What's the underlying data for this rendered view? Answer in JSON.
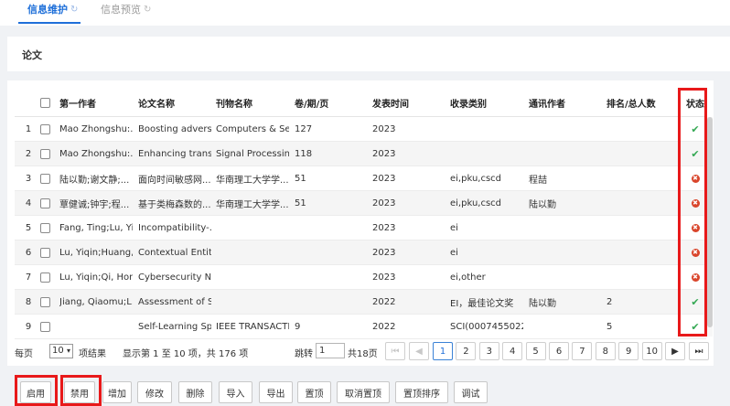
{
  "tabs": [
    {
      "label": "信息维护",
      "refresh_icon": "↻"
    },
    {
      "label": "信息预览",
      "refresh_icon": "↻"
    }
  ],
  "section": {
    "title": "论文"
  },
  "table": {
    "columns": [
      "第一作者",
      "论文名称",
      "刊物名称",
      "卷/期/页",
      "发表时间",
      "收录类别",
      "通讯作者",
      "排名/总人数",
      "状态"
    ],
    "rows": [
      {
        "idx": "1",
        "author": "Mao Zhongshu:...",
        "title": "Boosting advers...",
        "journal": "Computers & Se...",
        "vol": "127",
        "year": "2023",
        "index": "",
        "corresponding": "",
        "rank": "",
        "status": "enabled"
      },
      {
        "idx": "2",
        "author": "Mao Zhongshu:...",
        "title": "Enhancing trans...",
        "journal": "Signal Processin...",
        "vol": "118",
        "year": "2023",
        "index": "",
        "corresponding": "",
        "rank": "",
        "status": "enabled"
      },
      {
        "idx": "3",
        "author": "陆以勤;谢文静;...",
        "title": "面向时间敏感网...",
        "journal": "华南理工大学学...",
        "vol": "51",
        "year": "2023",
        "index": "ei,pku,cscd",
        "corresponding": "程喆",
        "rank": "",
        "status": "disabled"
      },
      {
        "idx": "4",
        "author": "覃健诚;钟宇;程...",
        "title": "基于类梅森数的...",
        "journal": "华南理工大学学...",
        "vol": "51",
        "year": "2023",
        "index": "ei,pku,cscd",
        "corresponding": "陆以勤",
        "rank": "",
        "status": "disabled"
      },
      {
        "idx": "5",
        "author": "Fang, Ting;Lu, Yi...",
        "title": "Incompatibility-...",
        "journal": "",
        "vol": "",
        "year": "2023",
        "index": "ei",
        "corresponding": "",
        "rank": "",
        "status": "disabled"
      },
      {
        "idx": "6",
        "author": "Lu, Yiqin;Huang,...",
        "title": "Contextual Entit...",
        "journal": "",
        "vol": "",
        "year": "2023",
        "index": "ei",
        "corresponding": "",
        "rank": "",
        "status": "disabled"
      },
      {
        "idx": "7",
        "author": "Lu, Yiqin;Qi, Hon...",
        "title": "Cybersecurity N...",
        "journal": "",
        "vol": "",
        "year": "2023",
        "index": "ei,other",
        "corresponding": "",
        "rank": "",
        "status": "disabled"
      },
      {
        "idx": "8",
        "author": "Jiang, Qiaomu;L...",
        "title": "Assessment of S...",
        "journal": "",
        "vol": "",
        "year": "2022",
        "index": "EI，最佳论文奖",
        "corresponding": "陆以勤",
        "rank": "2",
        "status": "enabled"
      },
      {
        "idx": "9",
        "author": "",
        "title": "Self-Learning Sp...",
        "journal": "IEEE TRANSACTI...",
        "vol": "9",
        "year": "2022",
        "index": "SCI(0007455022...",
        "corresponding": "",
        "rank": "5",
        "status": "enabled"
      }
    ]
  },
  "pagination": {
    "per_page_label": "每页",
    "per_page_value": "10",
    "per_page_suffix": "项结果",
    "summary": "显示第 1 至 10 项，共 176 项",
    "jump_label": "跳转",
    "jump_value": "1",
    "total_pages_label": "共18页",
    "pages": [
      "1",
      "2",
      "3",
      "4",
      "5",
      "6",
      "7",
      "8",
      "9",
      "10"
    ],
    "first_icon": "⏮",
    "prev_icon": "◀",
    "next_icon": "▶",
    "last_icon": "⏭",
    "current_page": "1"
  },
  "toolbar": {
    "buttons": [
      "启用",
      "禁用",
      "增加",
      "修改",
      "删除",
      "导入",
      "导出",
      "置顶",
      "取消置顶",
      "置顶排序",
      "调试"
    ]
  },
  "status_icons": {
    "enabled": "✔",
    "disabled": "✖"
  },
  "colors": {
    "accent": "#1e6fd9",
    "highlight": "#e8191a",
    "enabled": "#34a853",
    "disabled": "#d9452b"
  }
}
